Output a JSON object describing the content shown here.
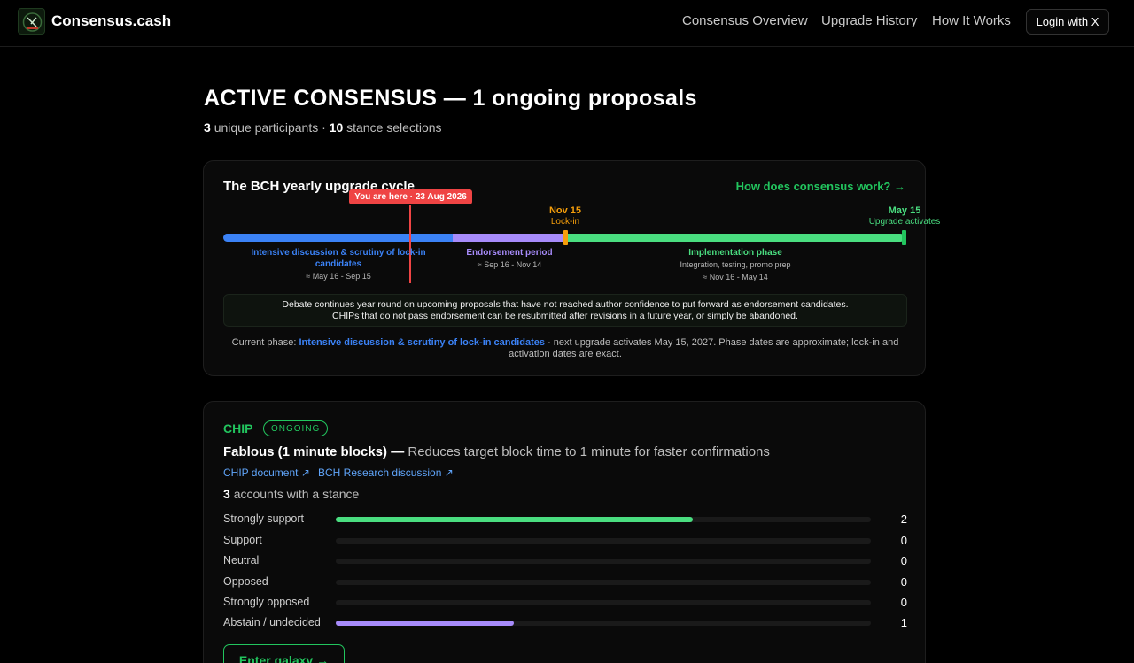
{
  "header": {
    "brand": "Consensus.cash",
    "nav": [
      "Consensus Overview",
      "Upgrade History",
      "How It Works"
    ],
    "login_label": "Login with X"
  },
  "main": {
    "title": "ACTIVE CONSENSUS — 1 ongoing proposals",
    "participants_count": "3",
    "participants_label": "unique participants ·",
    "stance_count": "10",
    "stance_label": "stance selections"
  },
  "cycle": {
    "title": "The BCH yearly upgrade cycle",
    "how_link": "How does consensus work? →",
    "you_are_here": "You are here · 23 Aug 2026",
    "lockin_date": "Nov 15",
    "lockin_label": "Lock-in",
    "activate_date": "May 15",
    "activate_label": "Upgrade activates",
    "phases": [
      {
        "name": "Intensive discussion & scrutiny of lock-in candidates",
        "sub": "≈ May 16 - Sep 15",
        "color": "#3b82f6"
      },
      {
        "name": "Endorsement period",
        "sub": "≈ Sep 16 - Nov 14",
        "color": "#a78bfa"
      },
      {
        "name": "Implementation phase",
        "sub": "Integration, testing, promo prep",
        "sub2": "≈ Nov 16 - May 14",
        "color": "#4ade80"
      }
    ],
    "info_line1": "Debate continues year round on upcoming proposals that have not reached author confidence to put forward as endorsement candidates.",
    "info_line2": "CHIPs that do not pass endorsement can be resubmitted after revisions in a future year, or simply be abandoned.",
    "current_prefix": "Current phase:",
    "current_phase": "Intensive discussion & scrutiny of lock-in candidates",
    "current_suffix": "· next upgrade activates May 15, 2027. Phase dates are approximate; lock-in and activation dates are exact."
  },
  "proposal": {
    "type": "CHIP",
    "status": "ONGOING",
    "name": "Fablous (1 minute blocks) —",
    "description": "Reduces target block time to 1 minute for faster confirmations",
    "links": [
      "CHIP document ↗",
      "BCH Research discussion ↗"
    ],
    "accounts_count": "3",
    "accounts_label": "accounts with a stance",
    "enter_label": "Enter galaxy →",
    "stances": [
      {
        "label": "Strongly support",
        "count": 2,
        "fill": 0.6667,
        "color": "#4ade80"
      },
      {
        "label": "Support",
        "count": 0,
        "fill": 0,
        "color": "#4ade80"
      },
      {
        "label": "Neutral",
        "count": 0,
        "fill": 0,
        "color": "#9ca3af"
      },
      {
        "label": "Opposed",
        "count": 0,
        "fill": 0,
        "color": "#f87171"
      },
      {
        "label": "Strongly opposed",
        "count": 0,
        "fill": 0,
        "color": "#ef4444"
      },
      {
        "label": "Abstain / undecided",
        "count": 1,
        "fill": 0.3333,
        "color": "#a78bfa"
      }
    ]
  }
}
